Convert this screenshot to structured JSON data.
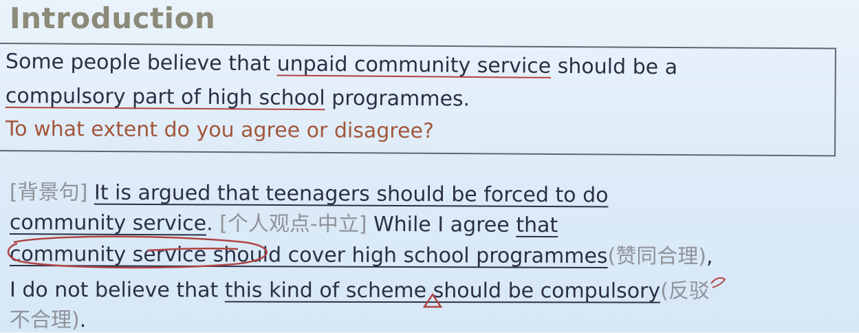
{
  "title": "Introduction",
  "prompt": {
    "line1_a": "Some people believe that ",
    "line1_b": "unpaid community service",
    "line1_c": " should be a",
    "line2_a": "compulsory part of high school",
    "line2_b": " programmes.",
    "line3": "To what extent do you agree or disagree?"
  },
  "paragraph": {
    "tag1": "[背景句] ",
    "s1a": "It is argued that teenagers should be forced to do",
    "s1b": "community service",
    "dot": ".",
    "tag2": " [个人观点-中立]",
    "s2a": " While I agree ",
    "s2b": "that",
    "s2c": "community service should cover high school programmes",
    "note1": "(赞同合理)",
    "comma": ",",
    "s3a": "I do not believe that ",
    "s3b": "this kind of scheme should be compulsory",
    "note2a": "(反驳",
    "note2b": "不合理)",
    "end": "."
  },
  "colors": {
    "text_dark": "#2b2f45",
    "text_rust": "#a2563a",
    "annotation_gray": "#8f9399",
    "ink_red": "#b04444"
  }
}
